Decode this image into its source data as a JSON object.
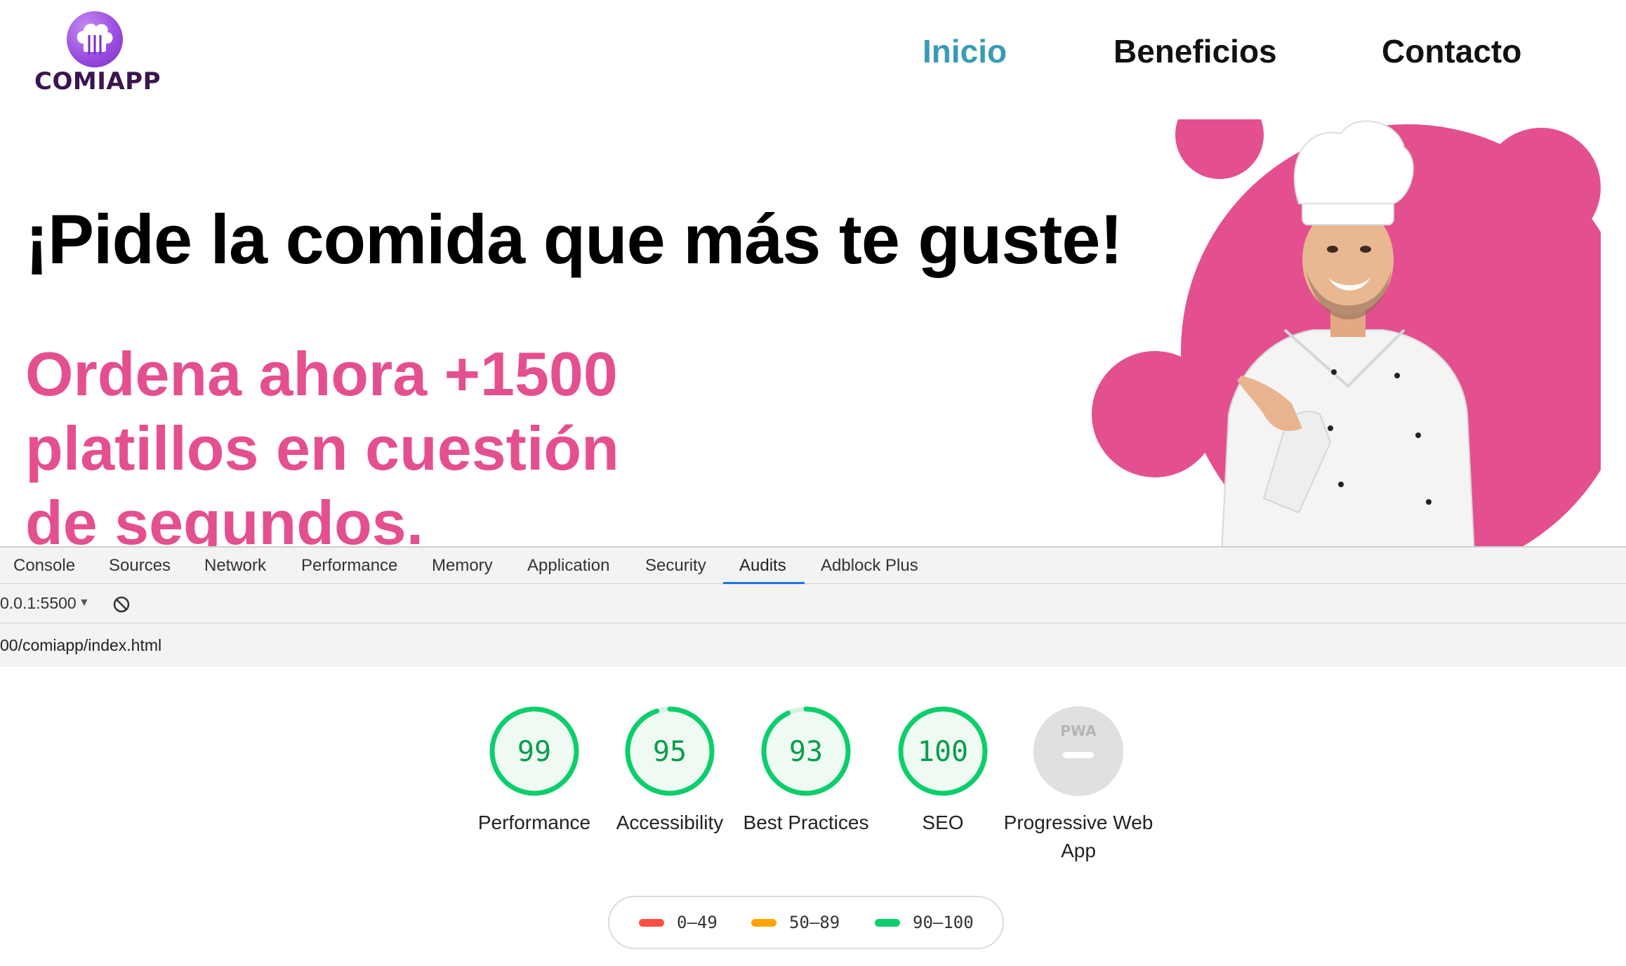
{
  "site": {
    "logo_text": "COMIAPP",
    "nav": [
      "Inicio",
      "Beneficios",
      "Contacto"
    ],
    "hero_title": "¡Pide la comida que más te guste!",
    "hero_subtitle_lines": [
      "Ordena ahora +1500",
      "platillos en cuestión",
      "de segundos."
    ],
    "colors": {
      "accent_pink": "#e4508f",
      "nav_active": "#3a9bb4",
      "logo_purple": "#9b4fe0"
    }
  },
  "devtools": {
    "tabs": [
      "Console",
      "Sources",
      "Network",
      "Performance",
      "Memory",
      "Application",
      "Security",
      "Audits",
      "Adblock Plus"
    ],
    "active_tab": "Audits",
    "host": "0.0.1:5500",
    "url": "00/comiapp/index.html",
    "clear_icon": "block-icon"
  },
  "audits": {
    "categories": [
      {
        "label": "Performance",
        "score": "99",
        "fraction": 0.99,
        "color": "#0cce6b"
      },
      {
        "label": "Accessibility",
        "score": "95",
        "fraction": 0.95,
        "color": "#0cce6b"
      },
      {
        "label": "Best Practices",
        "score": "93",
        "fraction": 0.93,
        "color": "#0cce6b"
      },
      {
        "label": "SEO",
        "score": "100",
        "fraction": 1.0,
        "color": "#0cce6b"
      },
      {
        "label": "Progressive Web App",
        "score": "PWA",
        "fraction": 0,
        "color": "#cccccc"
      }
    ],
    "legend": [
      {
        "range": "0–49",
        "color": "#ff4e42"
      },
      {
        "range": "50–89",
        "color": "#ffa400"
      },
      {
        "range": "90–100",
        "color": "#0cce6b"
      }
    ]
  }
}
